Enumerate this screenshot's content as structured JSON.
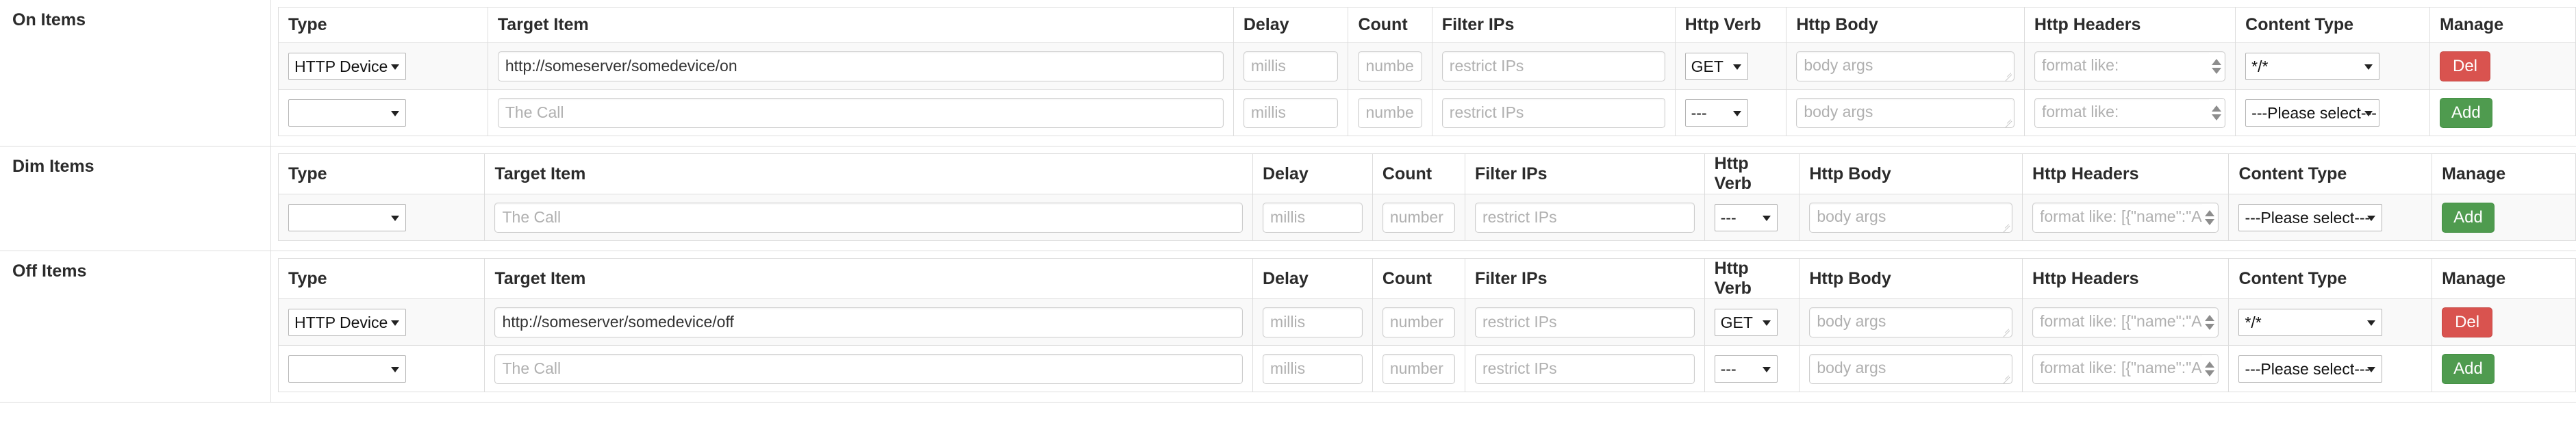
{
  "columns_on": [
    "Type",
    "Target Item",
    "Delay",
    "Count",
    "Filter IPs",
    "Http Verb",
    "Http Body",
    "Http Headers",
    "Content Type",
    "Manage"
  ],
  "columns_dim": [
    "Type",
    "Target Item",
    "Delay",
    "Count",
    "Filter IPs",
    "Http Verb",
    "Http Body",
    "Http Headers",
    "Content Type",
    "Manage"
  ],
  "columns_off": [
    "Type",
    "Target Item",
    "Delay",
    "Count",
    "Filter IPs",
    "Http Verb",
    "Http Body",
    "Http Headers",
    "Content Type",
    "Manage"
  ],
  "placeholders": {
    "target_item": "The Call",
    "delay": "millis",
    "count": "number",
    "filter_ips": "restrict IPs",
    "http_body": "body args",
    "http_headers_short": "format like:",
    "http_headers_long": "format like: [{\"name\":\"A"
  },
  "options": {
    "type_http_device": "HTTP Device",
    "type_blank": "",
    "verb_get": "GET",
    "verb_blank": "---",
    "content_any": "*/*",
    "content_please_select": "---Please select---"
  },
  "buttons": {
    "del": "Del",
    "add": "Add"
  },
  "colors": {
    "del": "#d9534f",
    "add": "#4f9b4f",
    "border": "#dddddd",
    "row_bg": "#f9f9f9"
  },
  "sections": [
    {
      "label": "On Items",
      "rows": [
        {
          "type": "HTTP Device",
          "target_item_value": "http://someserver/somedevice/on",
          "delay_value": "",
          "count_value": "",
          "filter_ips_value": "",
          "verb": "GET",
          "http_body_value": "",
          "http_headers_value": "",
          "content_type": "*/*",
          "manage": "Del"
        },
        {
          "type": "",
          "target_item_value": "",
          "delay_value": "",
          "count_value": "",
          "filter_ips_value": "",
          "verb": "---",
          "http_body_value": "",
          "http_headers_value": "",
          "content_type": "---Please select---",
          "manage": "Add"
        }
      ]
    },
    {
      "label": "Dim Items",
      "rows": [
        {
          "type": "",
          "target_item_value": "",
          "delay_value": "",
          "count_value": "",
          "filter_ips_value": "",
          "verb": "---",
          "http_body_value": "",
          "http_headers_value": "",
          "content_type": "---Please select---",
          "manage": "Add"
        }
      ]
    },
    {
      "label": "Off Items",
      "rows": [
        {
          "type": "HTTP Device",
          "target_item_value": "http://someserver/somedevice/off",
          "delay_value": "",
          "count_value": "",
          "filter_ips_value": "",
          "verb": "GET",
          "http_body_value": "",
          "http_headers_value": "",
          "content_type": "*/*",
          "manage": "Del"
        },
        {
          "type": "",
          "target_item_value": "",
          "delay_value": "",
          "count_value": "",
          "filter_ips_value": "",
          "verb": "---",
          "http_body_value": "",
          "http_headers_value": "",
          "content_type": "---Please select---",
          "manage": "Add"
        }
      ]
    }
  ]
}
